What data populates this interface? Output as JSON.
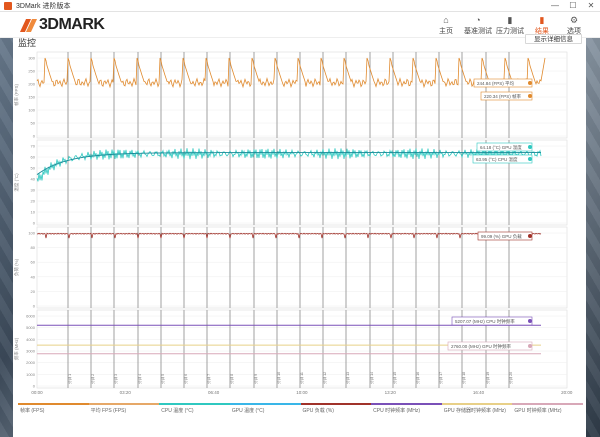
{
  "window": {
    "title": "3DMark 进阶版本",
    "controls": [
      "—",
      "☐",
      "✕"
    ]
  },
  "logo": {
    "text": "3DMARK"
  },
  "nav": [
    {
      "label": "主页",
      "icon": "home-icon",
      "glyph": "⌂",
      "active": false
    },
    {
      "label": "基准测试",
      "icon": "gauge-icon",
      "glyph": "◔",
      "active": false
    },
    {
      "label": "压力测试",
      "icon": "bar-chart-icon",
      "glyph": "▮",
      "active": false
    },
    {
      "label": "结果",
      "icon": "results-icon",
      "glyph": "▮",
      "active": true
    },
    {
      "label": "选项",
      "icon": "gear-icon",
      "glyph": "⚙",
      "active": false
    }
  ],
  "panel": {
    "title": "监控",
    "button": "显示详细信息"
  },
  "charts": {
    "fps": {
      "ylabel": "帧率 (FPS)",
      "ticks": [
        "300",
        "250",
        "200",
        "150",
        "100",
        "50",
        "0"
      ],
      "tags": [
        "244.84 (FPS) 平均",
        "220.34 (FPS) 帧率"
      ],
      "colors": [
        "#e08a2e",
        "#e08a2e"
      ]
    },
    "temp": {
      "ylabel": "温度 (°C)",
      "ticks": [
        "70",
        "60",
        "50",
        "40",
        "30",
        "20",
        "10",
        "0"
      ],
      "tags": [
        "64.18 (°C) GPU 温度",
        "63.95 (°C) CPU 温度"
      ],
      "colors": [
        "#2fc8c0",
        "#2fc8c0"
      ]
    },
    "load": {
      "ylabel": "负荷 (%)",
      "ticks": [
        "100",
        "80",
        "60",
        "40",
        "20",
        "0"
      ],
      "tags": [
        "99.09 (%) GPU 负载"
      ],
      "colors": [
        "#a0322a"
      ]
    },
    "clock": {
      "ylabel": "频率 (MHz)",
      "ticks": [
        "6000",
        "5000",
        "4000",
        "3000",
        "2000",
        "1000",
        "0"
      ],
      "tags": [
        "5207.07 (MHz) CPU 时钟频率",
        "2760.00 (MHz) GPU 时钟频率"
      ],
      "colors": [
        "#7a50b8",
        "#d8a8b8"
      ]
    }
  },
  "markers": [
    "分钟 1",
    "分钟 2",
    "分钟 3",
    "分钟 4",
    "分钟 5",
    "分钟 6",
    "分钟 7",
    "分钟 8",
    "分钟 9",
    "分钟 10",
    "分钟 11",
    "分钟 12",
    "分钟 13",
    "分钟 14",
    "分钟 15",
    "分钟 16",
    "分钟 17",
    "分钟 18",
    "分钟 19",
    "分钟 20"
  ],
  "xaxis": [
    "00:00",
    "03:20",
    "06:40",
    "10:00",
    "13:20",
    "16:40",
    "20:00"
  ],
  "legend": [
    {
      "label": "帧率 (FPS)",
      "color": "#e08a2e"
    },
    {
      "label": "平均 FPS (FPS)",
      "color": "#e6a868"
    },
    {
      "label": "CPU 温度 (°C)",
      "color": "#2fc8c0"
    },
    {
      "label": "GPU 温度 (°C)",
      "color": "#39b6e8"
    },
    {
      "label": "GPU 负载 (%)",
      "color": "#a0322a"
    },
    {
      "label": "CPU 时钟频率 (MHz)",
      "color": "#7a50b8"
    },
    {
      "label": "GPU 存储器时钟频率 (MHz)",
      "color": "#e8d088"
    },
    {
      "label": "GPU 时钟频率 (MHz)",
      "color": "#d8a8b8"
    }
  ]
}
